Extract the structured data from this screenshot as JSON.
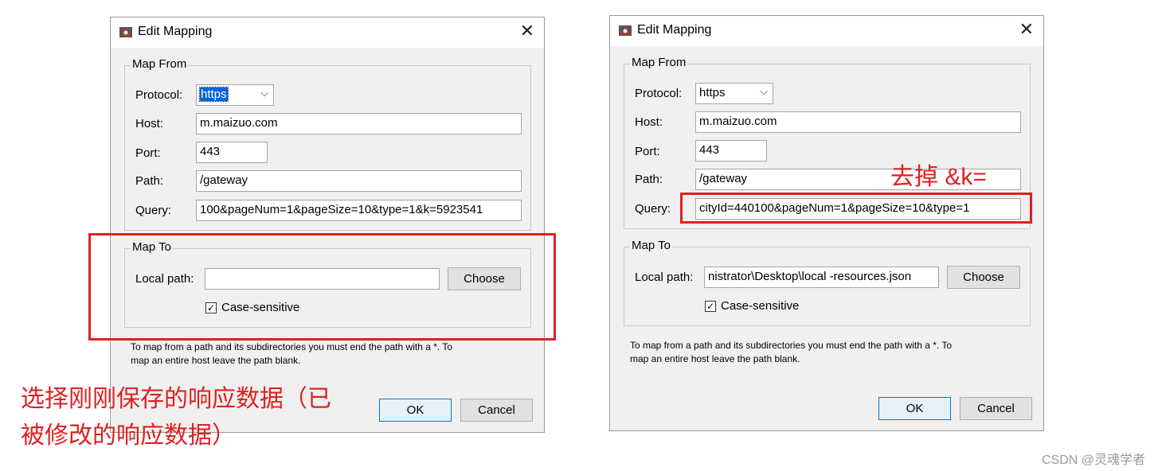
{
  "left_dialog": {
    "title": "Edit Mapping",
    "map_from": {
      "legend": "Map From",
      "protocol_label": "Protocol:",
      "protocol_value": "https",
      "host_label": "Host:",
      "host_value": "m.maizuo.com",
      "port_label": "Port:",
      "port_value": "443",
      "path_label": "Path:",
      "path_value": "/gateway",
      "query_label": "Query:",
      "query_value": "100&pageNum=1&pageSize=10&type=1&k=5923541"
    },
    "map_to": {
      "legend": "Map To",
      "local_path_label": "Local path:",
      "local_path_value": "",
      "choose_label": "Choose",
      "case_sensitive_label": "Case-sensitive"
    },
    "hint_line1": "To map from a path and its subdirectories you must end the path with a *. To",
    "hint_line2": "map an entire host leave the path blank.",
    "ok_label": "OK",
    "cancel_label": "Cancel"
  },
  "right_dialog": {
    "title": "Edit Mapping",
    "map_from": {
      "legend": "Map From",
      "protocol_label": "Protocol:",
      "protocol_value": "https",
      "host_label": "Host:",
      "host_value": "m.maizuo.com",
      "port_label": "Port:",
      "port_value": "443",
      "path_label": "Path:",
      "path_value": "/gateway",
      "query_label": "Query:",
      "query_value": "cityId=440100&pageNum=1&pageSize=10&type=1"
    },
    "map_to": {
      "legend": "Map To",
      "local_path_label": "Local path:",
      "local_path_value": "nistrator\\Desktop\\local -resources.json",
      "choose_label": "Choose",
      "case_sensitive_label": "Case-sensitive"
    },
    "hint_line1": "To map from a path and its subdirectories you must end the path with a *. To",
    "hint_line2": "map an entire host leave the path blank.",
    "ok_label": "OK",
    "cancel_label": "Cancel"
  },
  "annotations": {
    "left_note_line1": "选择刚刚保存的响应数据（已",
    "left_note_line2": "被修改的响应数据）",
    "right_note": "去掉 &k=",
    "color": "#e02020"
  },
  "watermark": "CSDN @灵魂学者"
}
